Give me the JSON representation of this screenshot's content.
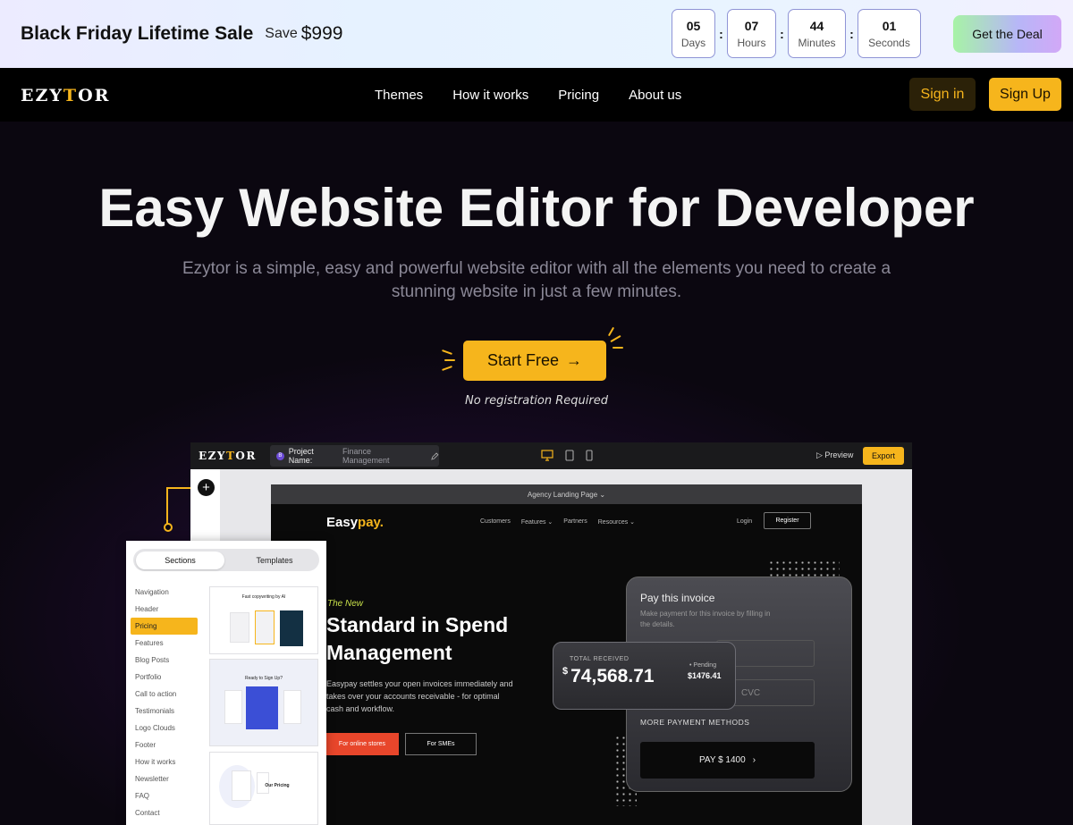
{
  "promo": {
    "title": "Black Friday Lifetime Sale",
    "save_label": "Save",
    "price": "$999",
    "countdown": [
      {
        "value": "05",
        "unit": "Days"
      },
      {
        "value": "07",
        "unit": "Hours"
      },
      {
        "value": "44",
        "unit": "Minutes"
      },
      {
        "value": "01",
        "unit": "Seconds"
      }
    ],
    "separator": ":",
    "deal_button": "Get the Deal"
  },
  "nav": {
    "logo_pre": "EZY",
    "logo_mid": "T",
    "logo_post": "OR",
    "links": [
      "Themes",
      "How it works",
      "Pricing",
      "About us"
    ],
    "sign_in": "Sign in",
    "sign_up": "Sign Up"
  },
  "hero": {
    "title": "Easy Website Editor for Developer",
    "subtitle": "Ezytor is a simple, easy and powerful website editor with all the elements you need to create a stunning website in just a few minutes.",
    "cta": "Start Free",
    "cta_arrow": "→",
    "note": "No registration Required"
  },
  "editor": {
    "logo_pre": "EZY",
    "logo_mid": "T",
    "logo_post": "OR",
    "project_label": "Project Name:",
    "project_value": "Finance Management",
    "project_badge": "B",
    "preview": "▷ Preview",
    "export": "Export",
    "add": "+",
    "page_name": "Agency Landing Page ⌄"
  },
  "site": {
    "logo_main": "Easy",
    "logo_accent": "pay.",
    "links": [
      "Customers",
      "Features ⌄",
      "Partners",
      "Resources ⌄"
    ],
    "login": "Login",
    "register": "Register",
    "eyebrow": "The New",
    "headline": "Standard in Spend Management",
    "description": "Easypay settles your open invoices immediately and takes over your accounts receivable - for optimal cash and workflow.",
    "btn_stores": "For online stores",
    "btn_smes": "For SMEs"
  },
  "pay_card": {
    "title": "Pay this invoice",
    "subtitle": "Make payment for this invoice by filling in the details.",
    "cvc": "CVC",
    "more": "MORE PAYMENT METHODS",
    "pay_button": "PAY $ 1400",
    "pay_chevron": "›"
  },
  "total_card": {
    "label": "TOTAL RECEIVED",
    "currency": "$",
    "value": "74,568.71",
    "pending_label": "• Pending",
    "pending_value": "$1476.41"
  },
  "panel": {
    "tab_sections": "Sections",
    "tab_templates": "Templates",
    "sections": [
      "Navigation",
      "Header",
      "Pricing",
      "Features",
      "Blog Posts",
      "Portfolio",
      "Call to action",
      "Testimonials",
      "Logo Clouds",
      "Footer",
      "How it works",
      "Newsletter",
      "FAQ",
      "Contact"
    ],
    "active_index": 2,
    "thumb_titles": [
      "Fast copywriting by AI",
      "Ready to Sign Up?",
      "Our Pricing"
    ]
  },
  "colors": {
    "accent": "#f6b51c",
    "site_accent": "#e8462b",
    "eyebrow": "#c8e04a"
  }
}
